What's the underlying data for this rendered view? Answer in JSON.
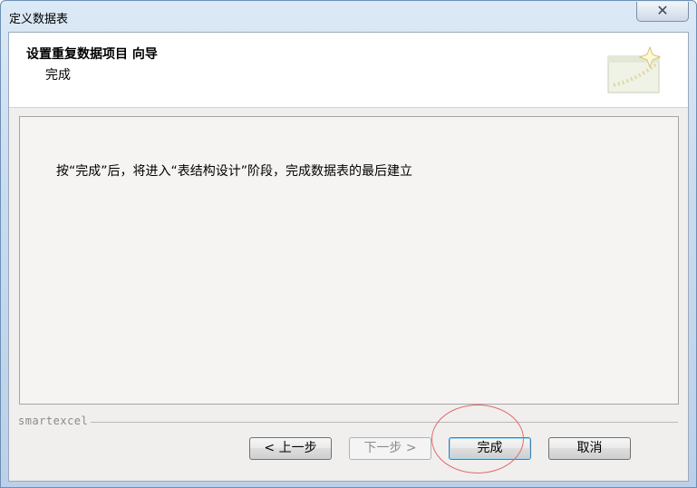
{
  "window": {
    "title": "定义数据表",
    "close_icon": "close-icon",
    "close_glyph": "✕"
  },
  "wizard": {
    "title": "设置重复数据项目  向导",
    "subtitle": "完成",
    "icon": "wizard-window-sparkle-icon"
  },
  "content": {
    "message": "按“完成”后，将进入“表结构设计”阶段，完成数据表的最后建立"
  },
  "footer": {
    "brand": "smartexcel",
    "buttons": {
      "back": "< 上一步",
      "next": "下一步 >",
      "finish": "完成",
      "cancel": "取消"
    }
  },
  "colors": {
    "title_bar": "#c9dbef",
    "annotation_circle": "#e06a6a",
    "default_button_border": "#3c7fb1"
  }
}
